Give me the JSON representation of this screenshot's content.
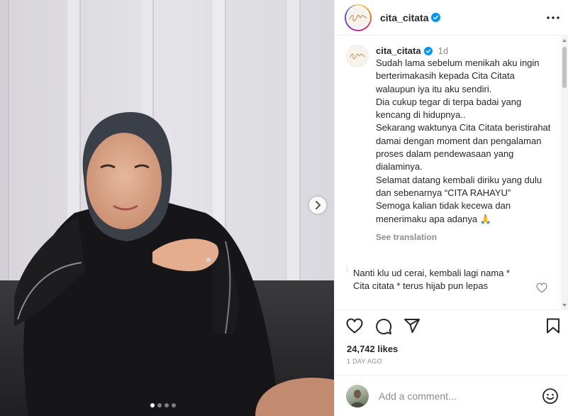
{
  "post": {
    "username": "cita_citata",
    "avatar_logo_text": "Cita Citata",
    "verified_icon": "verified-badge-icon",
    "more_icon": "more-dots-icon"
  },
  "caption": {
    "username": "cita_citata",
    "time": "1d",
    "text": "Sudah lama sebelum menikah aku ingin berterimakasih kepada Cita Citata walaupun iya itu aku sendiri.\nDia cukup tegar di terpa badai yang kencang di hidupnya..\nSekarang waktunya Cita Citata beristirahat damai dengan moment dan pengalaman proses dalam pendewasaan yang dialaminya.\nSelamat datang kembali diriku yang dulu dan sebenarnya “CITA RAHAYU”\nSemoga kalian tidak kecewa dan menerimaku apa adanya 🙏",
    "see_translation": "See translation"
  },
  "comment": {
    "text": "Nanti klu ud cerai, kembali lagi nama * Cita citata * terus hijab pun lepas"
  },
  "stats": {
    "likes": "24,742 likes",
    "time_ago": "1 DAY AGO"
  },
  "add_comment": {
    "placeholder": "Add a comment..."
  },
  "carousel": {
    "slide_count": 4,
    "active_slide": 1
  },
  "colors": {
    "verified": "#0095f6",
    "text": "#262626",
    "muted": "#8e8e8e"
  }
}
